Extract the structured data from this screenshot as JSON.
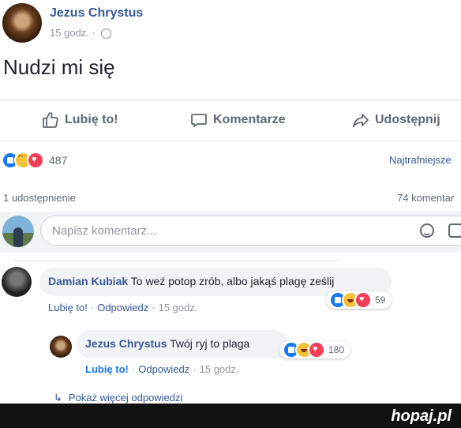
{
  "post": {
    "author": "Jezus Chrystus",
    "time": "15 godz.",
    "time_sep": "·",
    "text": "Nudzi mi się"
  },
  "actions": {
    "like": "Lubię to!",
    "comment": "Komentarze",
    "share": "Udostępnij"
  },
  "stats": {
    "reactions_count": "487",
    "sort_label": "Najtrafniejsze",
    "shares": "1 udostępnienie",
    "comments": "74 komentar"
  },
  "composer": {
    "placeholder": "Napisz komentarz..."
  },
  "comments": [
    {
      "author": "Damian Kubiak",
      "text": "To weź potop zrób, albo jakąś plagę ześlij",
      "like": "Lubię to!",
      "reply": "Odpowiedz",
      "time": "15 godz.",
      "reactions": "59"
    }
  ],
  "reply": {
    "author": "Jezus Chrystus",
    "text": "Twój ryj to plaga",
    "like": "Lubię to!",
    "reply": "Odpowiedz",
    "time": "15 godz.",
    "reactions": "180"
  },
  "more_replies": "Pokaż więcej odpowiedzi",
  "more_replies_arrow": "↳",
  "dot": "·",
  "watermark": "hopaj.pl",
  "colors": {
    "link": "#365899",
    "like_blue": "#1877f2",
    "love_red": "#f33e58",
    "haha_yellow": "#f7c23a",
    "footer": "#111111"
  }
}
